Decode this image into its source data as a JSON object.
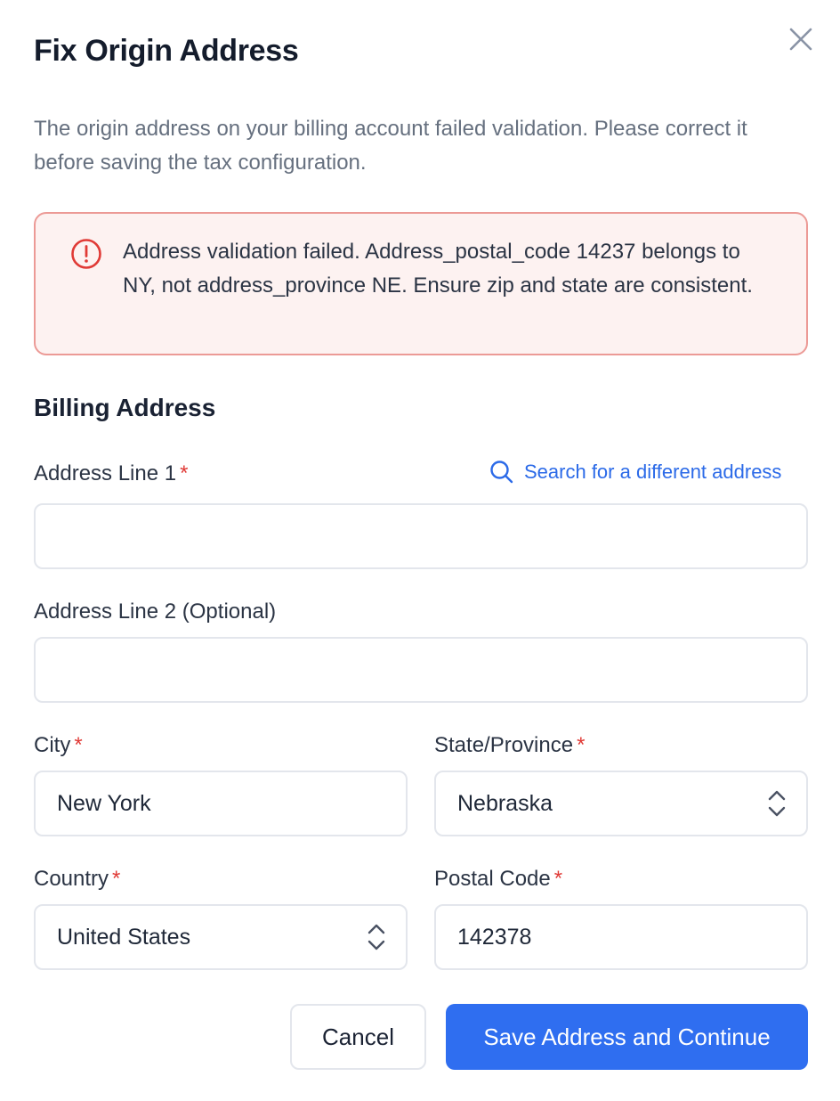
{
  "dialog": {
    "title": "Fix Origin Address",
    "description": "The origin address on your billing account failed validation. Please correct it before saving the tax configuration.",
    "close_icon": "close-icon"
  },
  "alert": {
    "icon": "alert-circle-icon",
    "message": "Address validation failed. Address_postal_code 14237 belongs to NY, not address_province NE. Ensure zip and state are consistent.",
    "colors": {
      "background": "#fdf2f1",
      "border": "#ec9a96",
      "icon": "#e03a36"
    }
  },
  "form": {
    "section_title": "Billing Address",
    "search_link": {
      "label": "Search for a different address",
      "icon": "search-icon",
      "color": "#2b6ae8"
    },
    "address_line_1": {
      "label": "Address Line 1",
      "required_mark": "*",
      "value": ""
    },
    "address_line_2": {
      "label": "Address Line 2 (Optional)",
      "value": ""
    },
    "city": {
      "label": "City",
      "required_mark": "*",
      "value": "New York"
    },
    "state": {
      "label": "State/Province",
      "required_mark": "*",
      "value": "Nebraska",
      "icon": "select-arrows-icon"
    },
    "country": {
      "label": "Country",
      "required_mark": "*",
      "value": "United States",
      "icon": "select-arrows-icon"
    },
    "postal_code": {
      "label": "Postal Code",
      "required_mark": "*",
      "value": "142378"
    }
  },
  "actions": {
    "cancel_label": "Cancel",
    "save_label": "Save Address and Continue",
    "primary_color": "#2f6ef0"
  }
}
